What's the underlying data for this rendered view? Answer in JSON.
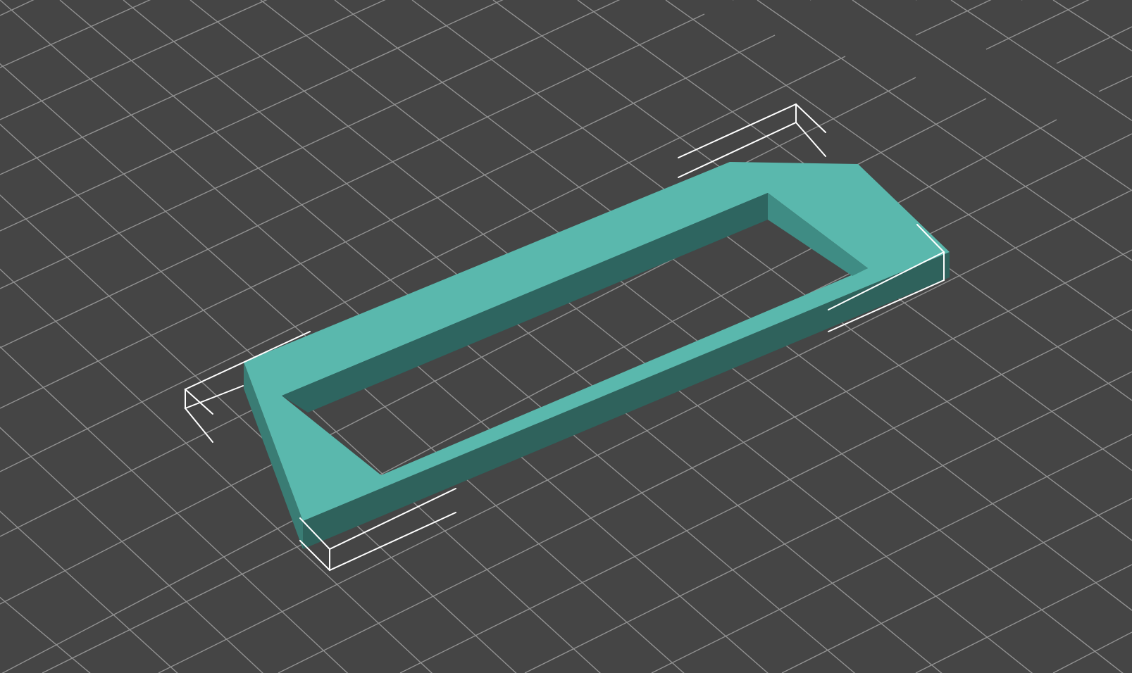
{
  "viewport": {
    "background_color": "#454545",
    "grid_color": "#9a9a9a",
    "grid_shown": true
  },
  "model": {
    "shape": "rectangular frame with open center and chamfered corners",
    "top_face_color": "#5ab8ad",
    "front_side_color": "#2f625c",
    "right_side_color": "#3f8c84",
    "inner_wall_color": "#2e6560"
  },
  "bounding_box_markers": {
    "color": "#ffffff",
    "count": 4
  }
}
